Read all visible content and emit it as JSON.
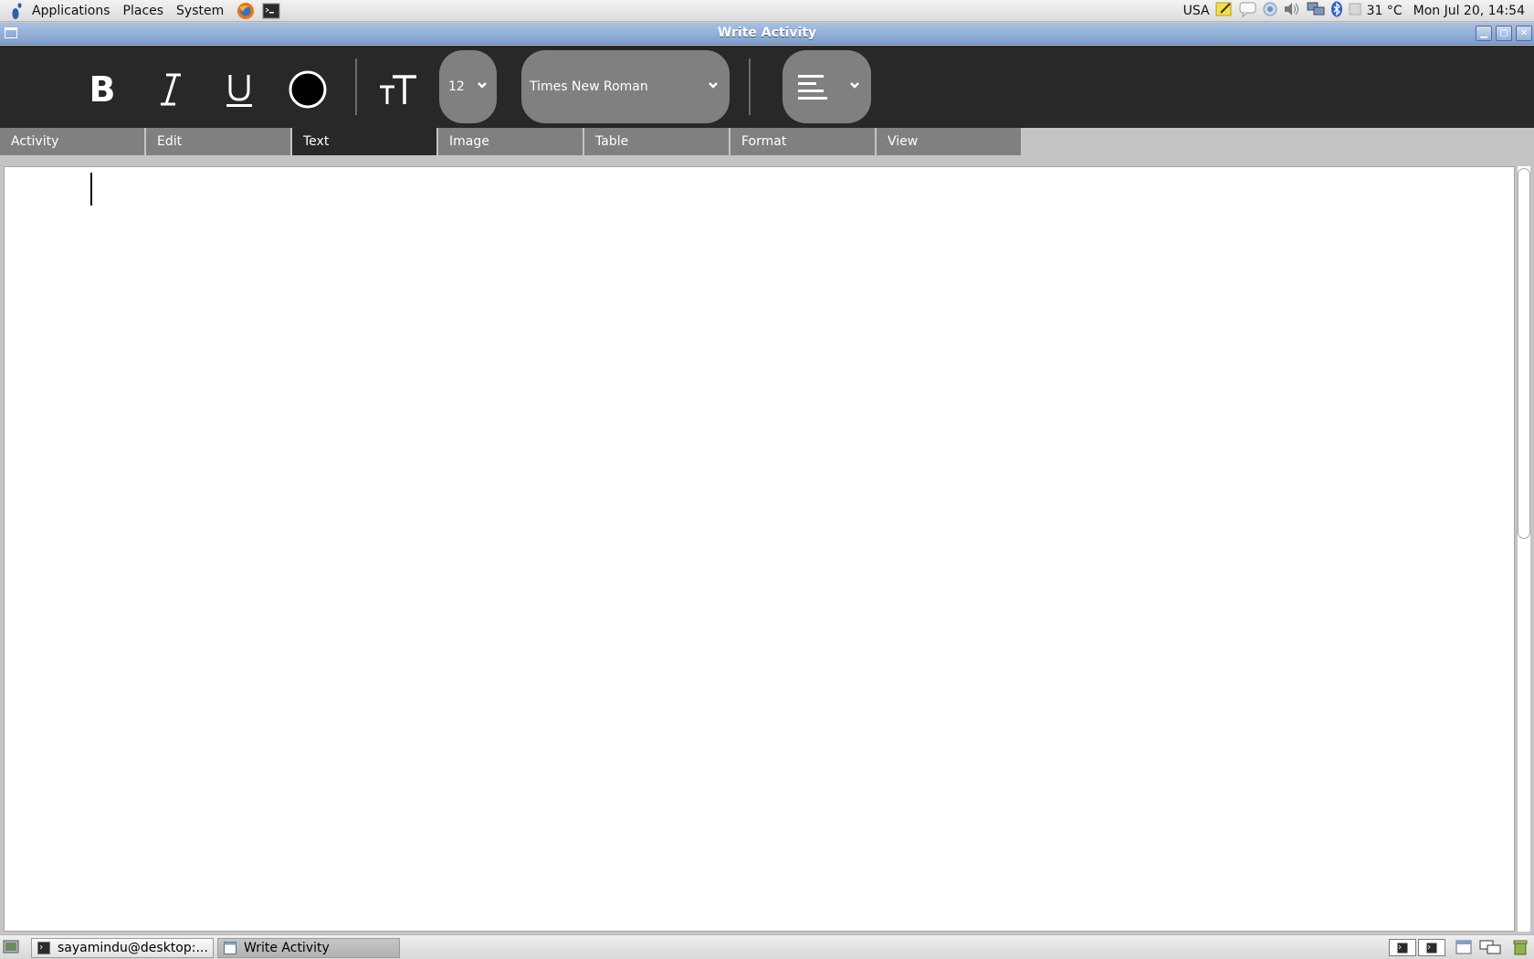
{
  "top_panel": {
    "menus": [
      "Applications",
      "Places",
      "System"
    ],
    "launchers": [
      "firefox-icon",
      "terminal-icon"
    ],
    "tray": {
      "keyboard_layout": "USA",
      "temperature": "31 °C",
      "clock": "Mon Jul 20, 14:54"
    }
  },
  "window": {
    "title": "Write Activity"
  },
  "toolbar": {
    "buttons": [
      "bold-icon",
      "italic-icon",
      "underline-icon",
      "text-color-icon",
      "text-size-icon",
      "alignment-icon"
    ],
    "font_size": "12",
    "font_family": "Times New Roman"
  },
  "tabs": [
    "Activity",
    "Edit",
    "Text",
    "Image",
    "Table",
    "Format",
    "View"
  ],
  "active_tab": "Text",
  "bottom_panel": {
    "tasks": [
      {
        "label": "sayamindu@desktop:...",
        "active": false
      },
      {
        "label": "Write Activity",
        "active": true
      }
    ]
  },
  "colors": {
    "toolbar_bg": "#282828",
    "combo_bg": "#808080",
    "tab_inactive": "#808080",
    "titlebar": "#7f9fcc"
  }
}
